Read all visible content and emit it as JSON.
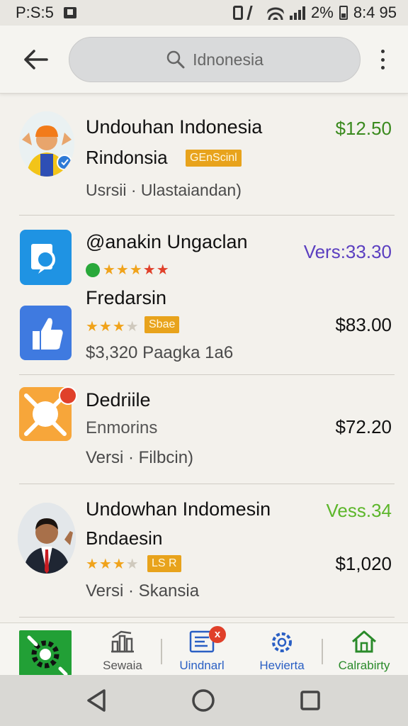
{
  "status_bar": {
    "left_text": "P:S:5",
    "battery": "2%",
    "time": "8:4 95"
  },
  "topbar": {
    "search_text": "Idnonesia"
  },
  "items": [
    {
      "title": "Undouhan Indonesia",
      "subtitle": "Rindonsia",
      "tag": "GEnScinl",
      "meta": "Usrsii · Ulastaiandan)",
      "price": "$12.50",
      "price_color": "#3a8a1e"
    },
    {
      "title": "@anakin Ungaclan",
      "rating": 4.5,
      "price": "Vers:33.30",
      "price_color": "#5b3fc0"
    },
    {
      "title": "Fredarsin",
      "rating": 3.5,
      "tag": "Sbae",
      "meta": "$3,320 Paagka 1a6",
      "price": "$83.00"
    },
    {
      "title": "Dedriile",
      "subtitle": "Enmorins",
      "meta": "Versi · Filbcin)",
      "price": "$72.20"
    },
    {
      "title": "Undowhan Indomesin",
      "subtitle": "Bndaesin",
      "rating": 3.5,
      "tag": "LS R",
      "meta": "Versi · Skansia",
      "price": "Vess.34",
      "price_color": "#5cb62a",
      "price2": "$1,020"
    }
  ],
  "bottom_nav": [
    {
      "label": "Sewaia",
      "icon": "chart-icon",
      "color": "#555555"
    },
    {
      "label": "Uindnarl",
      "icon": "list-doc-icon",
      "color": "#2a5fc4",
      "badge": "x"
    },
    {
      "label": "Hevierta",
      "icon": "gear-icon",
      "color": "#2a5fc4"
    },
    {
      "label": "Calrabirty",
      "icon": "home-icon",
      "color": "#2a8a2a"
    }
  ],
  "colors": {
    "accent_green": "#22a036",
    "badge_red": "#e0402a",
    "star": "#f0a31b"
  }
}
